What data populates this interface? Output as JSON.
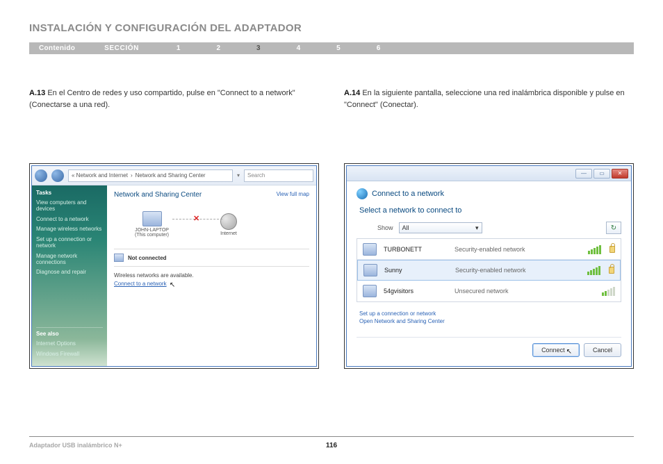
{
  "page": {
    "title": "INSTALACIÓN Y CONFIGURACIÓN DEL ADAPTADOR",
    "footer_product": "Adaptador USB inalámbrico N+",
    "page_number": "116"
  },
  "nav": {
    "contenido": "Contenido",
    "seccion": "SECCIÓN",
    "items": [
      "1",
      "2",
      "3",
      "4",
      "5",
      "6"
    ],
    "active_index": 2
  },
  "steps": {
    "a13_label": "A.13",
    "a13_text": "En el Centro de redes y uso compartido, pulse en \"Connect to a network\" (Conectarse a una red).",
    "a14_label": "A.14",
    "a14_text": "En la siguiente pantalla, seleccione una red inalámbrica disponible y pulse en \"Connect\" (Conectar)."
  },
  "shot1": {
    "breadcrumb_prefix": "« Network and Internet",
    "breadcrumb_current": "Network and Sharing Center",
    "search_placeholder": "Search",
    "side_header": "Tasks",
    "side_links": [
      "View computers and devices",
      "Connect to a network",
      "Manage wireless networks",
      "Set up a connection or network",
      "Manage network connections",
      "Diagnose and repair"
    ],
    "seealso_header": "See also",
    "seealso_links": [
      "Internet Options",
      "Windows Firewall"
    ],
    "main_heading": "Network and Sharing Center",
    "full_map": "View full map",
    "node_pc_name": "JOHN-LAPTOP",
    "node_pc_sub": "(This computer)",
    "node_internet": "Internet",
    "not_connected": "Not connected",
    "available_text": "Wireless networks are available.",
    "connect_link": "Connect to a network"
  },
  "shot2": {
    "window_title": "Connect to a network",
    "subtitle": "Select a network to connect to",
    "show_label": "Show",
    "show_value": "All",
    "networks": [
      {
        "name": "TURBONETT",
        "type": "Security-enabled network",
        "locked": true,
        "bars": 5
      },
      {
        "name": "Sunny",
        "type": "Security-enabled network",
        "locked": true,
        "bars": 5,
        "selected": true
      },
      {
        "name": "54gvisitors",
        "type": "Unsecured network",
        "locked": false,
        "bars": 2
      }
    ],
    "link_setup": "Set up a connection or network",
    "link_open_center": "Open Network and Sharing Center",
    "btn_connect": "Connect",
    "btn_cancel": "Cancel"
  }
}
